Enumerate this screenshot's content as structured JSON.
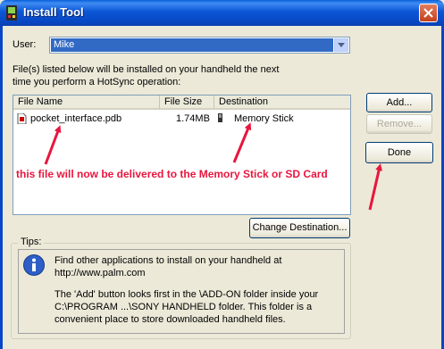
{
  "window": {
    "title": "Install Tool",
    "close_icon": "close-icon"
  },
  "user": {
    "label": "User:",
    "selected": "Mike"
  },
  "info": {
    "line1": "File(s) listed below will be installed on your handheld the next",
    "line2": "time you perform a HotSync operation:"
  },
  "table": {
    "columns": [
      "File Name",
      "File Size",
      "Destination"
    ],
    "rows": [
      {
        "name": "pocket_interface.pdb",
        "size": "1.74MB",
        "destination": "Memory Stick"
      }
    ]
  },
  "buttons": {
    "add": "Add...",
    "remove": "Remove...",
    "done": "Done",
    "change_destination": "Change Destination..."
  },
  "annotation": {
    "text": "this file will now be delivered to the Memory Stick or SD Card",
    "color": "#e8163e"
  },
  "tips": {
    "label": "Tips:",
    "para1": "Find other applications to install on your handheld at http://www.palm.com",
    "para2": "The 'Add' button looks first in the \\ADD-ON folder inside your C:\\PROGRAM ...\\SONY HANDHELD folder. This folder is a convenient place to store downloaded handheld files."
  }
}
